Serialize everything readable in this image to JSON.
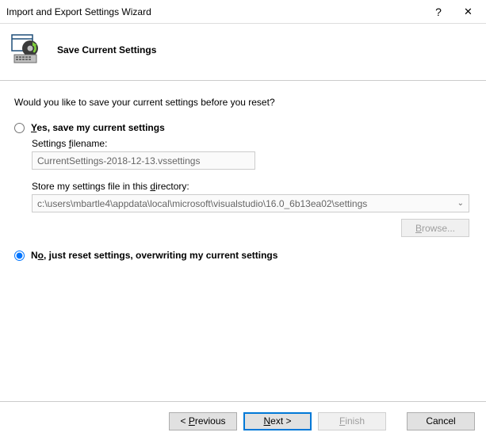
{
  "window": {
    "title": "Import and Export Settings Wizard",
    "help_tooltip": "?",
    "close_tooltip": "✕"
  },
  "header": {
    "title": "Save Current Settings"
  },
  "prompt": "Would you like to save your current settings before you reset?",
  "option_yes": {
    "label_pre": "",
    "label_ul": "Y",
    "label_post": "es, save my current settings",
    "selected": false
  },
  "filename": {
    "label_pre": "Settings ",
    "label_ul": "f",
    "label_post": "ilename:",
    "value": "CurrentSettings-2018-12-13.vssettings"
  },
  "directory": {
    "label_pre": "Store my settings file in this ",
    "label_ul": "d",
    "label_post": "irectory:",
    "value": "c:\\users\\mbartle4\\appdata\\local\\microsoft\\visualstudio\\16.0_6b13ea02\\settings"
  },
  "browse": {
    "label_ul": "B",
    "label_post": "rowse..."
  },
  "option_no": {
    "label_pre": "N",
    "label_ul": "o",
    "label_post": ", just reset settings, overwriting my current settings",
    "selected": true
  },
  "buttons": {
    "previous_pre": "< ",
    "previous_ul": "P",
    "previous_post": "revious",
    "next_pre": "",
    "next_ul": "N",
    "next_post": "ext >",
    "finish_pre": "",
    "finish_ul": "F",
    "finish_post": "inish",
    "cancel": "Cancel"
  }
}
